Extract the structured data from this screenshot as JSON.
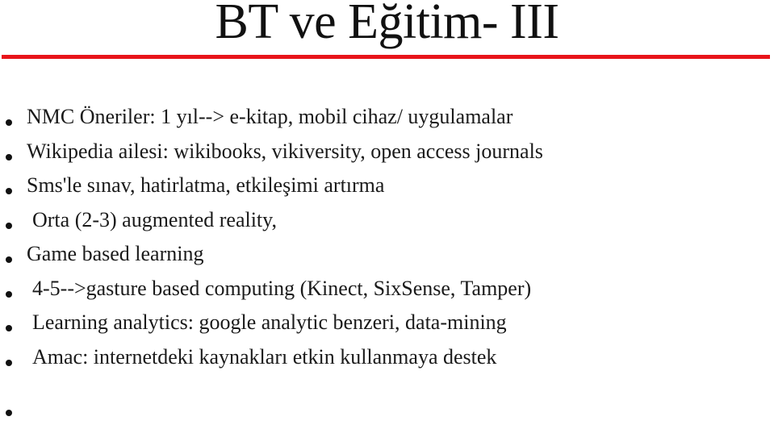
{
  "slide": {
    "title": "BT ve Eğitim- III",
    "accent_color": "#e8141a",
    "bullets": [
      {
        "text": "NMC Öneriler: 1 yıl--> e-kitap, mobil cihaz/ uygulamalar"
      },
      {
        "text": "Wikipedia ailesi: wikibooks, vikiversity, open access journals"
      },
      {
        "text": "Sms'le sınav, hatirlatma, etkileşimi artırma"
      },
      {
        "text": "Orta (2-3) augmented reality,"
      },
      {
        "text": "Game based learning"
      },
      {
        "text": "4-5-->gasture based computing (Kinect, SixSense, Tamper)"
      },
      {
        "text": "Learning analytics: google analytic benzeri, data-mining"
      },
      {
        "text": "Amac: internetdeki kaynakları etkin kullanmaya destek"
      },
      {
        "text": ""
      }
    ]
  }
}
